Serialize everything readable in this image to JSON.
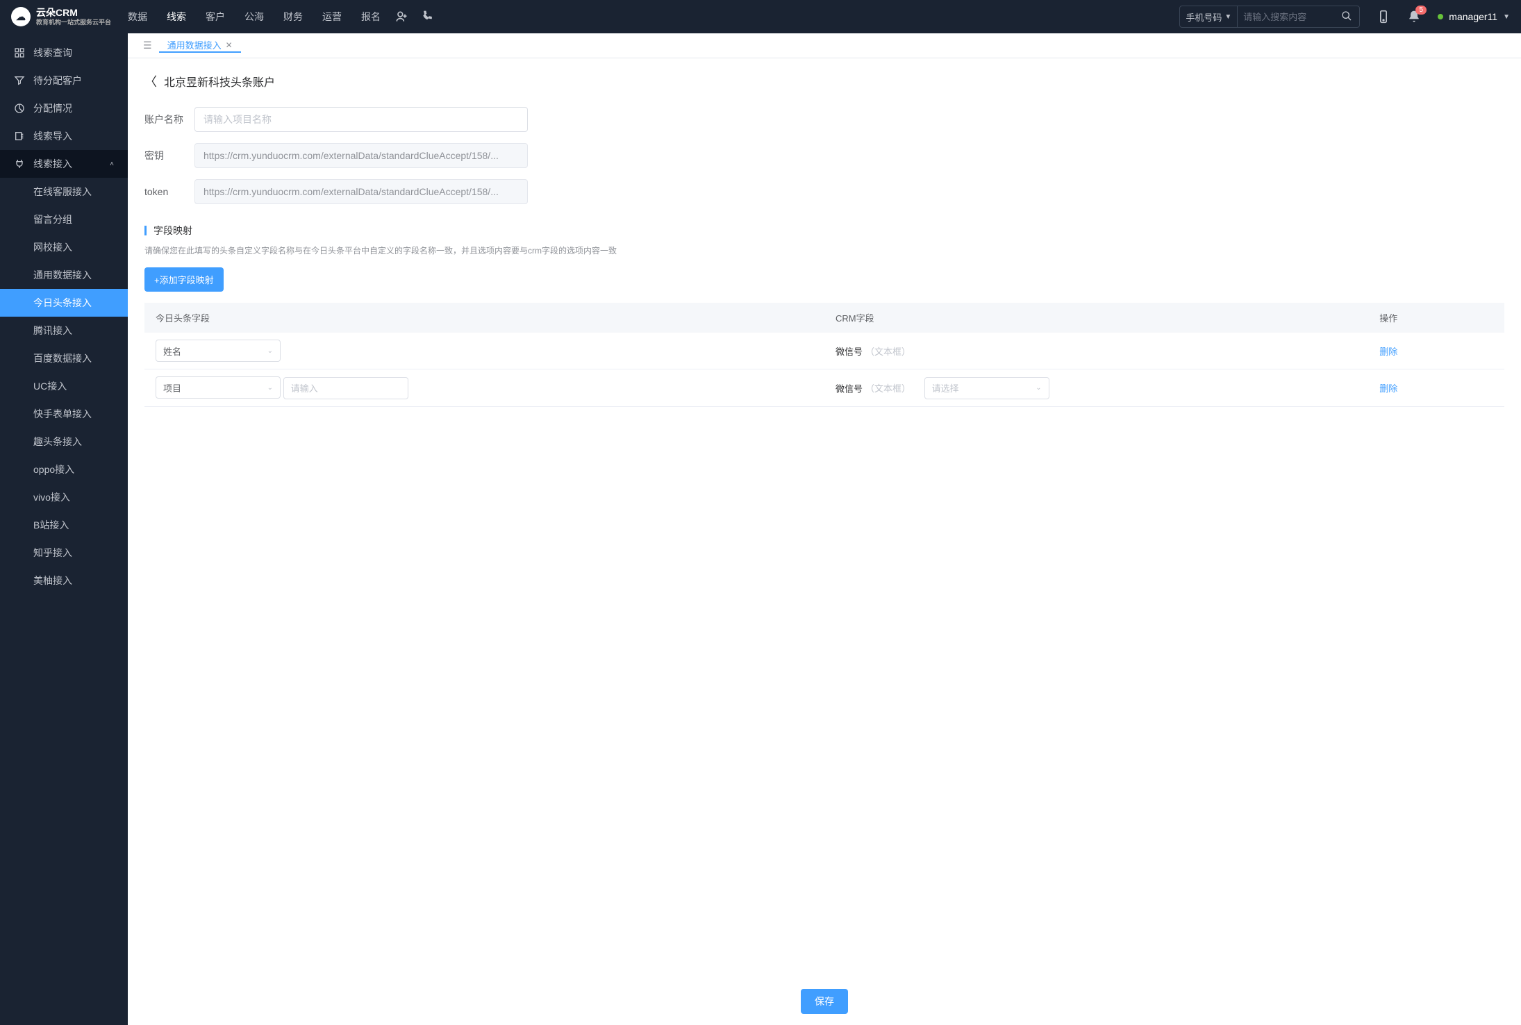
{
  "logo": {
    "brand": "云朵CRM",
    "subtitle": "教育机构一站式服务云平台"
  },
  "topNav": {
    "items": [
      "数据",
      "线索",
      "客户",
      "公海",
      "财务",
      "运营",
      "报名"
    ],
    "activeIndex": 1
  },
  "search": {
    "selectLabel": "手机号码",
    "placeholder": "请输入搜索内容"
  },
  "notificationCount": "5",
  "user": {
    "name": "manager11"
  },
  "sidebar": {
    "main": [
      {
        "icon": "grid",
        "label": "线索查询"
      },
      {
        "icon": "filter",
        "label": "待分配客户"
      },
      {
        "icon": "pie",
        "label": "分配情况"
      },
      {
        "icon": "export",
        "label": "线索导入"
      }
    ],
    "expandable": {
      "icon": "plug",
      "label": "线索接入"
    },
    "subs": [
      "在线客服接入",
      "留言分组",
      "网校接入",
      "通用数据接入",
      "今日头条接入",
      "腾讯接入",
      "百度数据接入",
      "UC接入",
      "快手表单接入",
      "趣头条接入",
      "oppo接入",
      "vivo接入",
      "B站接入",
      "知乎接入",
      "美柚接入"
    ],
    "activeSubIndex": 4
  },
  "tabs": [
    {
      "label": "通用数据接入",
      "active": true
    }
  ],
  "page": {
    "title": "北京昱新科技头条账户",
    "accountNameLabel": "账户名称",
    "accountNamePlaceholder": "请输入项目名称",
    "secretLabel": "密钥",
    "secretValue": "https://crm.yunduocrm.com/externalData/standardClueAccept/158/...",
    "tokenLabel": "token",
    "tokenValue": "https://crm.yunduocrm.com/externalData/standardClueAccept/158/...",
    "section": {
      "title": "字段映射",
      "desc": "请确保您在此填写的头条自定义字段名称与在今日头条平台中自定义的字段名称一致，并且选项内容要与crm字段的选项内容一致"
    },
    "addButton": "+添加字段映射",
    "tableHeaders": {
      "col1": "今日头条字段",
      "col2": "CRM字段",
      "col3": "操作"
    },
    "rows": [
      {
        "fieldSelect": "姓名",
        "extraInputPlaceholder": null,
        "crmLabel": "微信号",
        "crmHint": "（文本框）",
        "crmSelectPlaceholder": null,
        "action": "删除"
      },
      {
        "fieldSelect": "项目",
        "extraInputPlaceholder": "请输入",
        "crmLabel": "微信号",
        "crmHint": "（文本框）",
        "crmSelectPlaceholder": "请选择",
        "action": "删除"
      }
    ],
    "saveButton": "保存"
  }
}
